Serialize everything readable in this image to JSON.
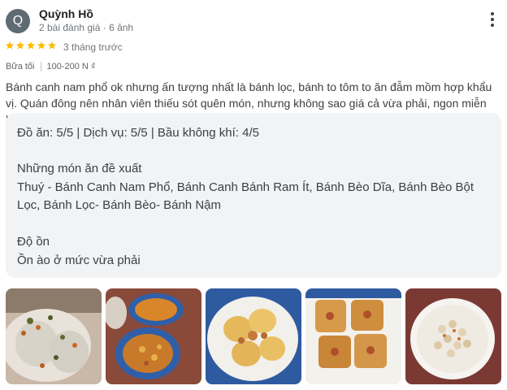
{
  "reviewer": {
    "avatar_letter": "Q",
    "name": "Quỳnh Hồ",
    "meta": "2 bài đánh giá · 6 ảnh"
  },
  "rating": {
    "stars": 5,
    "time": "3 tháng trước"
  },
  "tags": {
    "meal": "Bữa tối",
    "price": "100-200 N ₫"
  },
  "review_text": "Bánh canh nam phổ ok nhưng ấn tượng nhất là bánh lọc, bánh to tôm to ăn đẫm mồm hợp khẩu vị. Quán đông nên nhân viên thiếu sót quên món, nhưng không sao giá cả vừa phải, ngon miễn bàn.",
  "details": {
    "scores": "Đồ ăn: 5/5  |  Dịch vụ: 5/5  |  Bầu không khí: 4/5",
    "recommended_heading": "Những món ăn đề xuất",
    "recommended_line1": "Thuý - Bánh Canh Nam Phổ, Bánh Canh Bánh Ram Ít, Bánh Bèo Dĩa, Bánh Bèo Bột",
    "recommended_line2": "Lọc, Bánh Lọc- Bánh Bèo- Bánh Nậm",
    "noise_heading": "Độ ồn",
    "noise_value": "Ồn ào ở mức vừa phải"
  },
  "colors": {
    "star": "#fbbc04",
    "avatar": "#5f6b72",
    "box": "#f1f3f4"
  },
  "icons": {
    "star": "star-icon",
    "more": "more-vertical-icon"
  }
}
